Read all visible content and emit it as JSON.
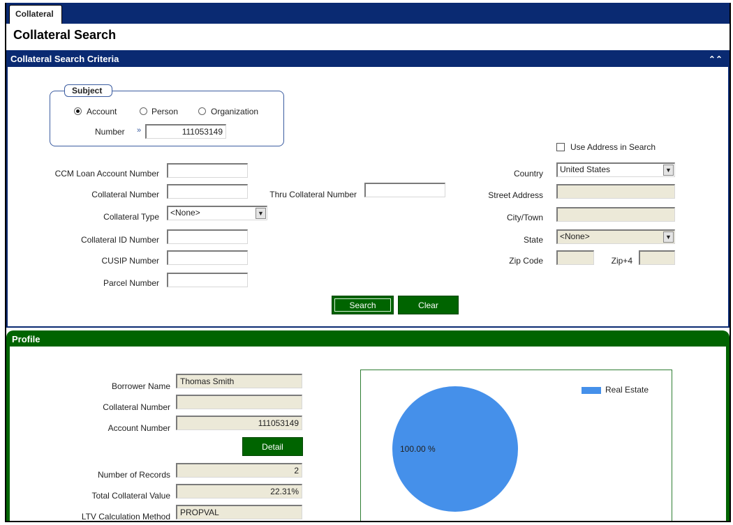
{
  "tab": {
    "label": "Collateral"
  },
  "page": {
    "title": "Collateral Search"
  },
  "criteria": {
    "header": "Collateral Search Criteria",
    "subject": {
      "legend": "Subject",
      "options": [
        "Account",
        "Person",
        "Organization"
      ],
      "selected": "Account",
      "number_label": "Number",
      "number_value": "111053149"
    },
    "use_address_label": "Use Address in Search",
    "left_fields": {
      "ccm_loan_label": "CCM Loan Account Number",
      "collateral_number_label": "Collateral Number",
      "collateral_type_label": "Collateral Type",
      "collateral_type_value": "<None>",
      "collateral_id_label": "Collateral ID Number",
      "cusip_label": "CUSIP Number",
      "parcel_label": "Parcel Number",
      "thru_collateral_label": "Thru Collateral Number"
    },
    "right_fields": {
      "country_label": "Country",
      "country_value": "United States",
      "street_label": "Street Address",
      "city_label": "City/Town",
      "state_label": "State",
      "state_value": "<None>",
      "zip_label": "Zip Code",
      "zip4_label": "Zip+4"
    },
    "buttons": {
      "search": "Search",
      "clear": "Clear"
    }
  },
  "profile": {
    "header": "Profile",
    "borrower_name_label": "Borrower Name",
    "borrower_name_value": "Thomas Smith",
    "collateral_number_label": "Collateral Number",
    "collateral_number_value": "",
    "account_number_label": "Account Number",
    "account_number_value": "111053149",
    "detail_button": "Detail",
    "records_label": "Number of Records",
    "records_value": "2",
    "total_value_label": "Total Collateral Value",
    "total_value_value": "22.31%",
    "ltv_label": "LTV Calculation Method",
    "ltv_value": "PROPVAL"
  },
  "colors": {
    "navy": "#0a2a72",
    "green": "#006400",
    "pie_blue": "#4590ea"
  },
  "chart_data": {
    "type": "pie",
    "categories": [
      "Real Estate"
    ],
    "values": [
      100.0
    ],
    "data_labels": [
      "100.00 %"
    ],
    "legend": [
      "Real Estate"
    ],
    "legend_placement": "top-right"
  }
}
